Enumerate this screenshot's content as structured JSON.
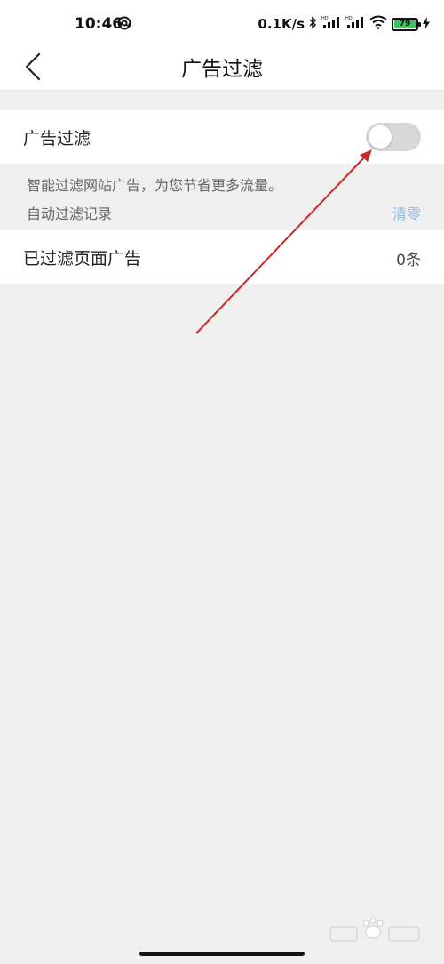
{
  "status_bar": {
    "time": "10:46",
    "network_speed": "0.1K/s",
    "battery_level": "79"
  },
  "header": {
    "title": "广告过滤"
  },
  "ad_filter": {
    "label": "广告过滤",
    "enabled": false,
    "description": "智能过滤网站广告，为您节省更多流量。"
  },
  "auto_record": {
    "label": "自动过滤记录",
    "clear_label": "清零"
  },
  "filtered_pages": {
    "label": "已过滤页面广告",
    "count": "0条"
  },
  "colors": {
    "accent_link": "#8fbce6",
    "annotation_arrow": "#cc2a2a",
    "battery": "#35c759",
    "toggle_off": "#d7d7d7"
  }
}
